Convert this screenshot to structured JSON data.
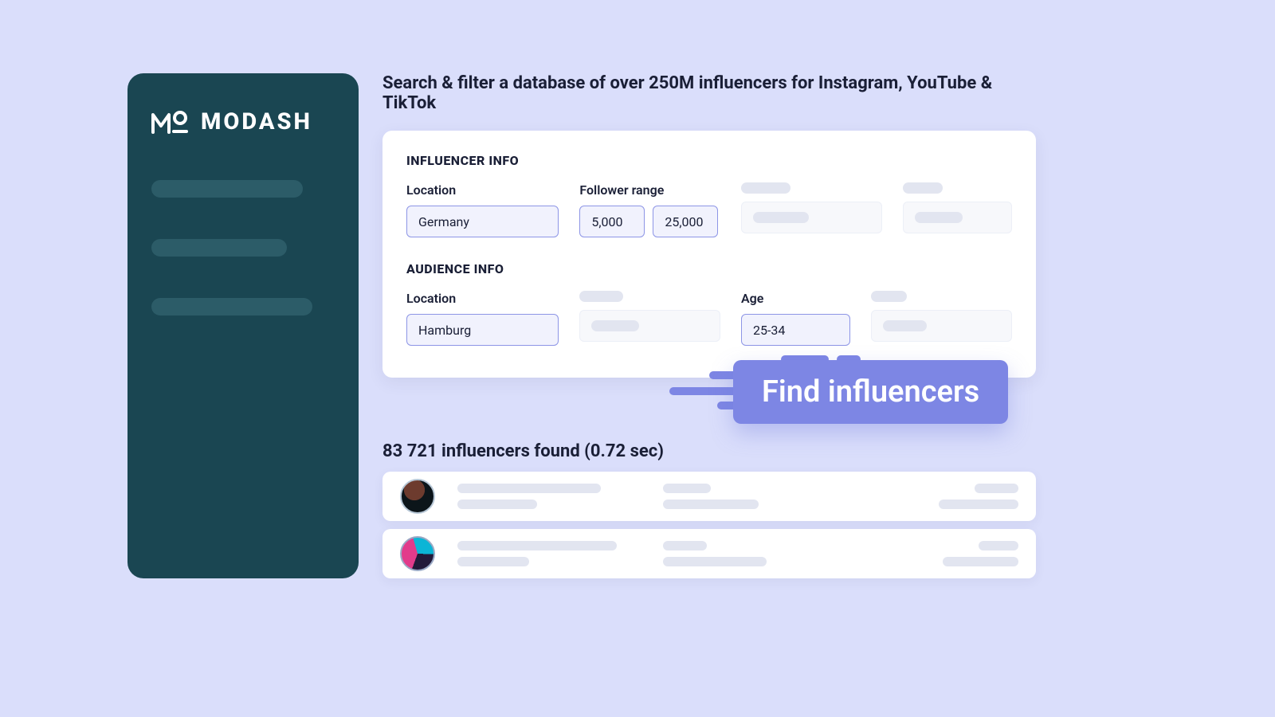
{
  "brand": {
    "name": "MODASH"
  },
  "headline": "Search & filter a database of over 250M influencers for Instagram, YouTube & TikTok",
  "filters": {
    "influencer": {
      "section_label": "INFLUENCER INFO",
      "location": {
        "label": "Location",
        "value": "Germany"
      },
      "follower_range": {
        "label": "Follower range",
        "min": "5,000",
        "max": "25,000"
      }
    },
    "audience": {
      "section_label": "AUDIENCE INFO",
      "location": {
        "label": "Location",
        "value": "Hamburg"
      },
      "age": {
        "label": "Age",
        "value": "25-34"
      }
    }
  },
  "cta": {
    "label": "Find influencers"
  },
  "results": {
    "heading": "83 721 influencers found (0.72 sec)",
    "count": 83721,
    "time_sec": 0.72
  },
  "colors": {
    "page_bg": "#dadefb",
    "sidebar_bg": "#1a4652",
    "accent": "#7d86e4",
    "field_border": "#8d95e6",
    "field_bg": "#f1f2fd"
  }
}
